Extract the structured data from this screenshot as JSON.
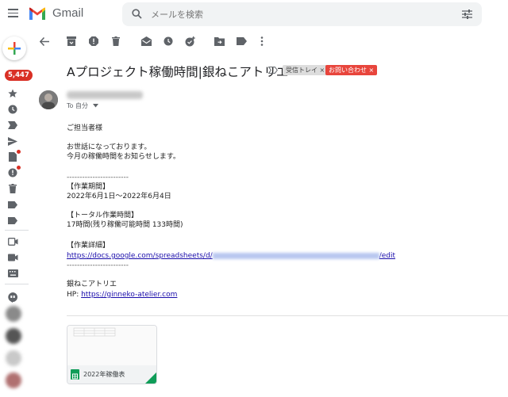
{
  "app": {
    "name": "Gmail",
    "logo_letter": "M"
  },
  "search": {
    "placeholder": "メールを検索"
  },
  "sidebar": {
    "inbox_count": "5,447"
  },
  "toolbar": {
    "icons": [
      "back-arrow-icon",
      "archive-icon",
      "report-spam-icon",
      "delete-icon",
      "mark-unread-icon",
      "snooze-icon",
      "add-task-icon",
      "move-to-icon",
      "label-icon",
      "more-vert-icon"
    ]
  },
  "message": {
    "subject": "Aプロジェクト稼働時間|銀ねこアトリエ",
    "labels": [
      "受信トレイ",
      "お問い合わせ"
    ],
    "label_colors": {
      "inbox": "#dddddd",
      "inquiry": "#e8453c"
    },
    "to_line": "To 自分",
    "greeting": "ご担当者様",
    "intro_1": "お世話になっております。",
    "intro_2": "今月の稼働時間をお知らせします。",
    "divider_line": "------------------------",
    "period_heading": "【作業期間】",
    "period_value": "2022年6月1日〜2022年6月4日",
    "total_heading": "【トータル作業時間】",
    "total_value": "17時間(残り稼働可能時間 133時間)",
    "detail_heading": "【作業詳細】",
    "detail_link_prefix": "https://docs.google.com/spreadsheets/d/",
    "detail_link_suffix": "/edit",
    "signature_name": "銀ねこアトリエ",
    "signature_hp_label": "HP: ",
    "signature_hp_link": "https://ginneko-atelier.com"
  },
  "attachment": {
    "name": "2022年稼働表"
  }
}
